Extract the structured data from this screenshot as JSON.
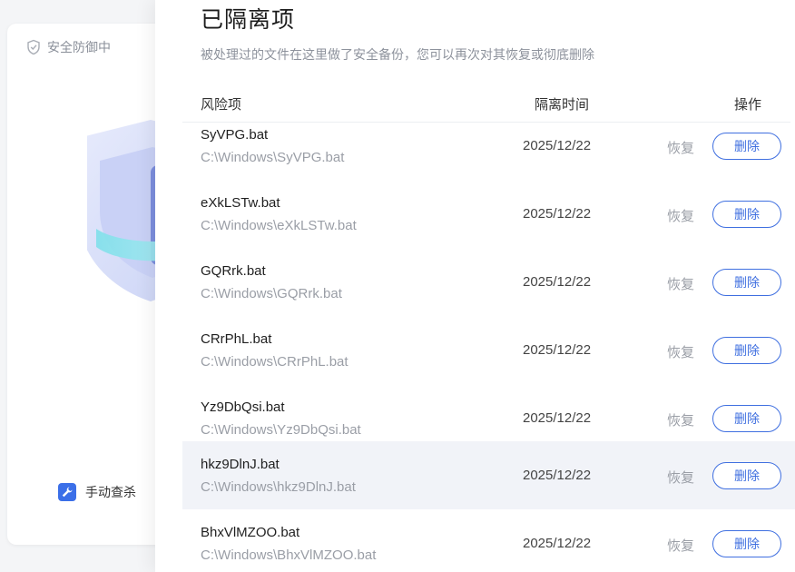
{
  "background": {
    "status_text": "安全防御中",
    "manual_scan_label": "手动查杀"
  },
  "drawer": {
    "title": "已隔离项",
    "subtitle": "被处理过的文件在这里做了安全备份，您可以再次对其恢复或彻底删除",
    "columns": {
      "name": "风险项",
      "time": "隔离时间",
      "action": "操作"
    },
    "items": [
      {
        "name": "SyVPG.bat",
        "path": "C:\\Windows\\SyVPG.bat",
        "time": "2025/12/22",
        "restore": "恢复",
        "delete": "删除"
      },
      {
        "name": "eXkLSTw.bat",
        "path": "C:\\Windows\\eXkLSTw.bat",
        "time": "2025/12/22",
        "restore": "恢复",
        "delete": "删除"
      },
      {
        "name": "GQRrk.bat",
        "path": "C:\\Windows\\GQRrk.bat",
        "time": "2025/12/22",
        "restore": "恢复",
        "delete": "删除"
      },
      {
        "name": "CRrPhL.bat",
        "path": "C:\\Windows\\CRrPhL.bat",
        "time": "2025/12/22",
        "restore": "恢复",
        "delete": "删除"
      },
      {
        "name": "Yz9DbQsi.bat",
        "path": "C:\\Windows\\Yz9DbQsi.bat",
        "time": "2025/12/22",
        "restore": "恢复",
        "delete": "删除"
      },
      {
        "name": "hkz9DlnJ.bat",
        "path": "C:\\Windows\\hkz9DlnJ.bat",
        "time": "2025/12/22",
        "restore": "恢复",
        "delete": "删除"
      },
      {
        "name": "BhxVlMZOO.bat",
        "path": "C:\\Windows\\BhxVlMZOO.bat",
        "time": "2025/12/22",
        "restore": "恢复",
        "delete": "删除"
      }
    ]
  },
  "colors": {
    "accent": "#3f6fe0",
    "row_highlight": "#f1f3f8"
  }
}
